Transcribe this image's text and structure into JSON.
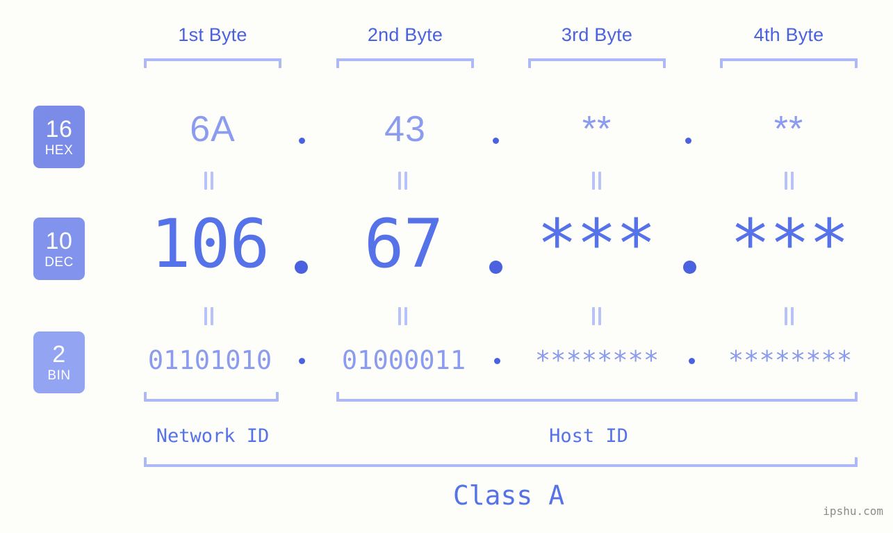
{
  "meta": {
    "watermark": "ipshu.com",
    "accent_strong": "#4a62e0",
    "accent_mid": "#5672e8",
    "accent_light": "#8b9bef",
    "accent_pale": "#adb8f7",
    "background": "#fdfdfa"
  },
  "byte_headers": [
    {
      "label": "1st Byte"
    },
    {
      "label": "2nd Byte"
    },
    {
      "label": "3rd Byte"
    },
    {
      "label": "4th Byte"
    }
  ],
  "bases": [
    {
      "id": "hex",
      "number": "16",
      "name": "HEX",
      "color": "#7b8ce8"
    },
    {
      "id": "dec",
      "number": "10",
      "name": "DEC",
      "color": "#8193ec"
    },
    {
      "id": "bin",
      "number": "2",
      "name": "BIN",
      "color": "#92a4f2"
    }
  ],
  "rows": {
    "hex": {
      "values": [
        "6A",
        "43",
        "**",
        "**"
      ],
      "separator": "."
    },
    "dec": {
      "values": [
        "106",
        "67",
        "***",
        "***"
      ],
      "separator": "."
    },
    "bin": {
      "values": [
        "01101010",
        "01000011",
        "********",
        "********"
      ],
      "separator": "."
    }
  },
  "equals_symbol": "=",
  "segments": {
    "network_id": "Network ID",
    "host_id": "Host ID",
    "class": "Class A"
  }
}
